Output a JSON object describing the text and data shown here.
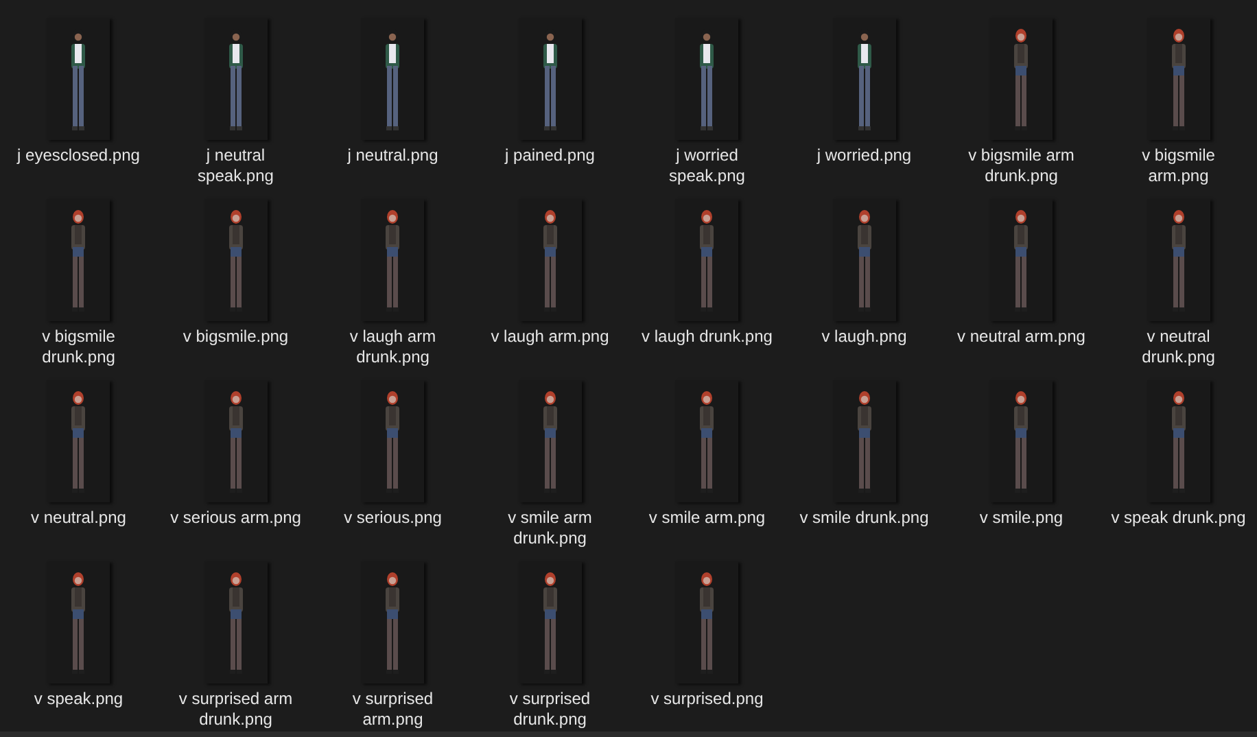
{
  "files": [
    {
      "name": "j eyesclosed.png",
      "kind": "j"
    },
    {
      "name": "j neutral speak.png",
      "kind": "j"
    },
    {
      "name": "j neutral.png",
      "kind": "j"
    },
    {
      "name": "j pained.png",
      "kind": "j"
    },
    {
      "name": "j worried speak.png",
      "kind": "j"
    },
    {
      "name": "j worried.png",
      "kind": "j"
    },
    {
      "name": "v bigsmile arm drunk.png",
      "kind": "v"
    },
    {
      "name": "v bigsmile arm.png",
      "kind": "v"
    },
    {
      "name": "v bigsmile drunk.png",
      "kind": "v"
    },
    {
      "name": "v bigsmile.png",
      "kind": "v"
    },
    {
      "name": "v laugh arm drunk.png",
      "kind": "v"
    },
    {
      "name": "v laugh arm.png",
      "kind": "v"
    },
    {
      "name": "v laugh drunk.png",
      "kind": "v"
    },
    {
      "name": "v laugh.png",
      "kind": "v"
    },
    {
      "name": "v neutral arm.png",
      "kind": "v"
    },
    {
      "name": "v neutral drunk.png",
      "kind": "v"
    },
    {
      "name": "v neutral.png",
      "kind": "v"
    },
    {
      "name": "v serious arm.png",
      "kind": "v"
    },
    {
      "name": "v serious.png",
      "kind": "v"
    },
    {
      "name": "v smile arm drunk.png",
      "kind": "v"
    },
    {
      "name": "v smile arm.png",
      "kind": "v"
    },
    {
      "name": "v smile drunk.png",
      "kind": "v"
    },
    {
      "name": "v smile.png",
      "kind": "v"
    },
    {
      "name": "v speak drunk.png",
      "kind": "v"
    },
    {
      "name": "v speak.png",
      "kind": "v"
    },
    {
      "name": "v surprised arm drunk.png",
      "kind": "v"
    },
    {
      "name": "v surprised arm.png",
      "kind": "v"
    },
    {
      "name": "v surprised drunk.png",
      "kind": "v"
    },
    {
      "name": "v surprised.png",
      "kind": "v"
    }
  ]
}
